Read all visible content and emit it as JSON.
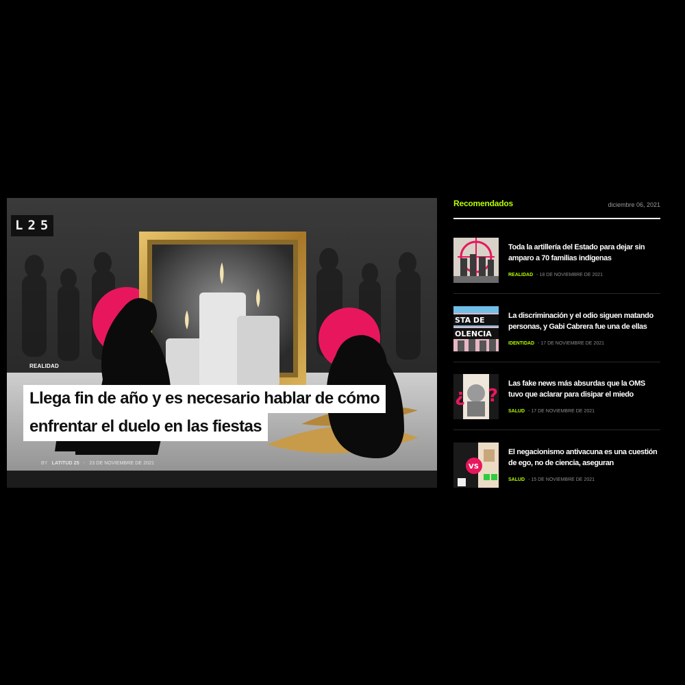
{
  "hero": {
    "logo": "L25",
    "category": "REALIDAD",
    "headline_line1": "Llega fin de año y es necesario hablar de cómo",
    "headline_line2": "enfrentar el duelo en las fiestas",
    "by": "BY",
    "author": "LATITUD 25",
    "separator": "-",
    "date": "23 DE NOVIEMBRE DE 2021"
  },
  "sidebar": {
    "title": "Recomendados",
    "date": "diciembre 06, 2021",
    "items": [
      {
        "title": "Toda la artillería del Estado para dejar sin amparo a 70 familias indígenas",
        "category": "REALIDAD",
        "date": "- 18 DE NOVIEMBRE DE 2021"
      },
      {
        "title": "La discriminación y el odio siguen matando personas, y Gabi Cabrera fue una de ellas",
        "category": "IDENTIDAD",
        "date": "- 17 DE NOVIEMBRE DE 2021"
      },
      {
        "title": "Las fake news más absurdas que la OMS tuvo que aclarar para disipar el miedo",
        "category": "SALUD",
        "date": "- 17 DE NOVIEMBRE DE 2021"
      },
      {
        "title": "El negacionismo antivacuna es una cuestión de ego, no de ciencia, aseguran",
        "category": "SALUD",
        "date": "- 15 DE NOVIEMBRE DE 2021"
      }
    ]
  },
  "colors": {
    "accent": "#b7ff00",
    "pink": "#e8175d",
    "background": "#000000"
  }
}
